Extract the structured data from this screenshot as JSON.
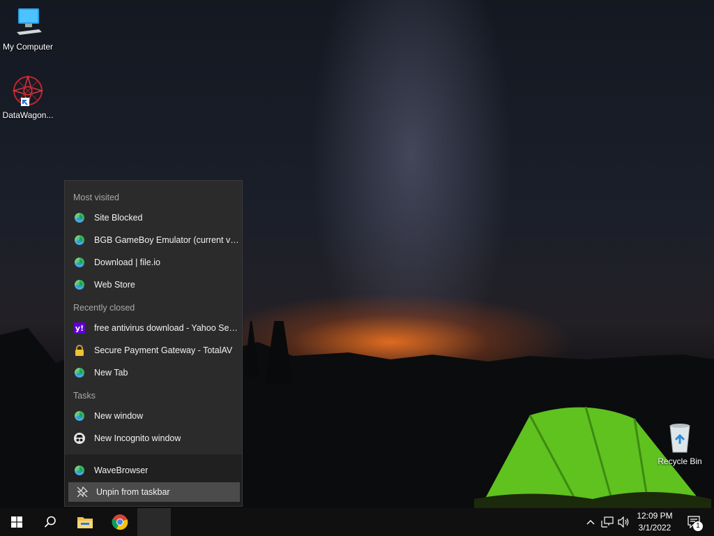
{
  "desktop": {
    "icons": [
      {
        "label": "My Computer"
      },
      {
        "label": "DataWagon..."
      },
      {
        "label": "Recycle Bin"
      }
    ]
  },
  "jumplist": {
    "sections": {
      "most_visited": "Most visited",
      "recently_closed": "Recently closed",
      "tasks": "Tasks"
    },
    "most_visited": [
      {
        "label": "Site Blocked",
        "icon": "edge-icon"
      },
      {
        "label": "BGB GameBoy Emulator (current versi...",
        "icon": "edge-icon"
      },
      {
        "label": "Download | file.io",
        "icon": "edge-icon"
      },
      {
        "label": "Web Store",
        "icon": "edge-icon"
      }
    ],
    "recently_closed": [
      {
        "label": "free antivirus download - Yahoo Searc...",
        "icon": "yahoo-icon"
      },
      {
        "label": "Secure Payment Gateway - TotalAV",
        "icon": "lock-icon"
      },
      {
        "label": "New Tab",
        "icon": "edge-icon"
      }
    ],
    "tasks": [
      {
        "label": "New window",
        "icon": "edge-icon"
      },
      {
        "label": "New Incognito window",
        "icon": "incognito-icon"
      }
    ],
    "app_name": "WaveBrowser",
    "unpin_label": "Unpin from taskbar"
  },
  "taskbar": {
    "pinned": [
      "start-icon",
      "search-icon",
      "file-explorer-icon",
      "chrome-icon",
      "wavebrowser-icon"
    ],
    "clock": {
      "time": "12:09 PM",
      "date": "3/1/2022"
    },
    "notification_count": "1"
  }
}
